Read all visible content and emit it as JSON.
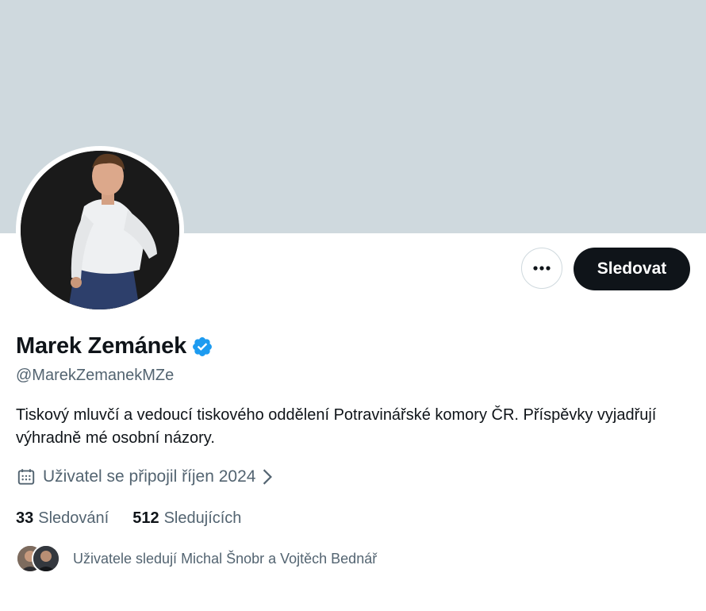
{
  "profile": {
    "name": "Marek Zemánek",
    "handle": "@MarekZemanekMZe",
    "bio": "Tiskový mluvčí a vedoucí tiskového oddělení Potravinářské komory ČR. Příspěvky vyjadřují výhradně mé osobní názory.",
    "joined": "Uživatel se připojil říjen 2024",
    "verified_icon": "verified-badge-icon"
  },
  "actions": {
    "more_icon": "more-dots-icon",
    "follow_label": "Sledovat"
  },
  "stats": {
    "following_count": "33",
    "following_label": "Sledování",
    "followers_count": "512",
    "followers_label": "Sledujících"
  },
  "followed_by": {
    "text": "Uživatele sledují Michal Šnobr a Vojtěch Bednář"
  },
  "colors": {
    "banner": "#cfd9de",
    "primary_text": "#0f1419",
    "secondary_text": "#536471",
    "verified_blue": "#1d9bf0",
    "follow_button_bg": "#0f1419"
  }
}
